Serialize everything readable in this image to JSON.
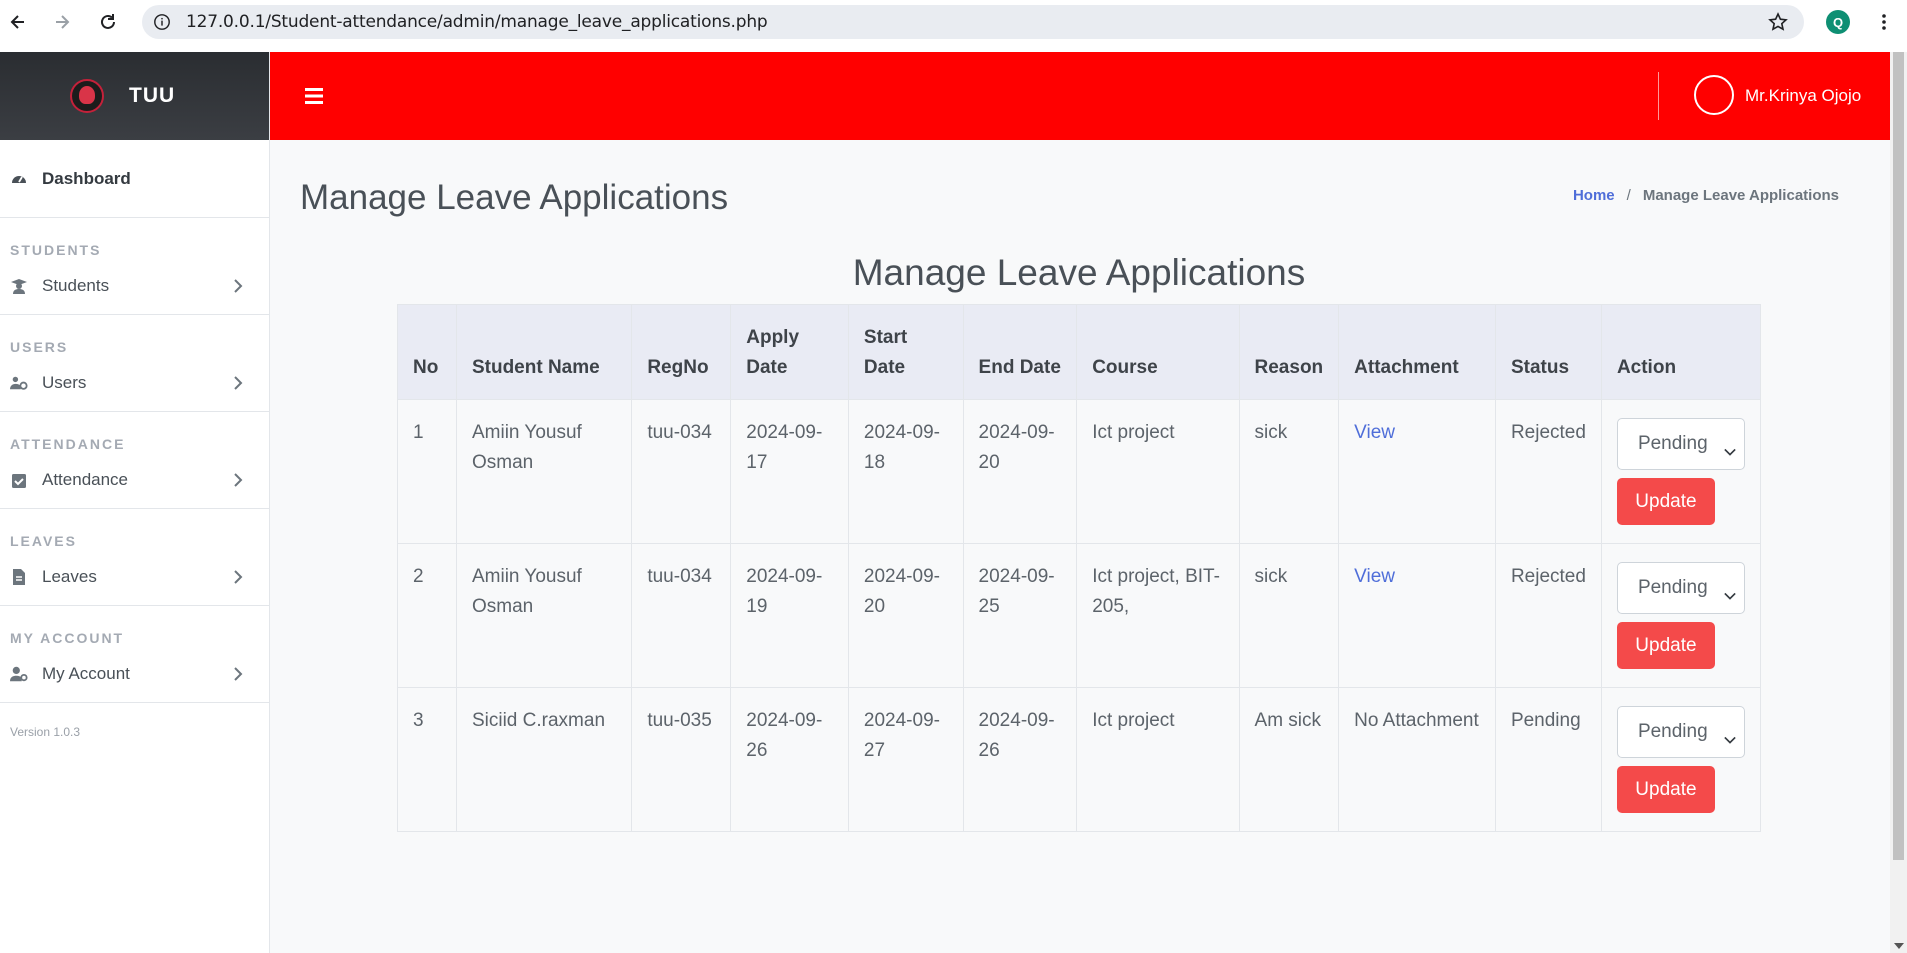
{
  "browser": {
    "url": "127.0.0.1/Student-attendance/admin/manage_leave_applications.php",
    "profile_initial": "Q"
  },
  "brand": {
    "name": "TUU"
  },
  "sidebar": {
    "dashboard": "Dashboard",
    "sections": [
      {
        "label": "STUDENTS",
        "item": "Students"
      },
      {
        "label": "USERS",
        "item": "Users"
      },
      {
        "label": "ATTENDANCE",
        "item": "Attendance"
      },
      {
        "label": "LEAVES",
        "item": "Leaves"
      },
      {
        "label": "MY ACCOUNT",
        "item": "My Account"
      }
    ],
    "version": "Version 1.0.3"
  },
  "header": {
    "user_name": "Mr.Krinya Ojojo",
    "accent_color": "#ff0000"
  },
  "page": {
    "title": "Manage Leave Applications",
    "breadcrumb": {
      "home": "Home",
      "separator": "/",
      "current": "Manage Leave Applications"
    },
    "table_title": "Manage Leave Applications"
  },
  "table": {
    "headers": {
      "no": "No",
      "student_name": "Student Name",
      "regno": "RegNo",
      "apply_date": "Apply Date",
      "start_date": "Start Date",
      "end_date": "End Date",
      "course": "Course",
      "reason": "Reason",
      "attachment": "Attachment",
      "status": "Status",
      "action": "Action"
    },
    "rows": [
      {
        "no": "1",
        "student_name": "Amiin Yousuf Osman",
        "regno": "tuu-034",
        "apply_date": "2024-09-17",
        "start_date": "2024-09-18",
        "end_date": "2024-09-20",
        "course": "Ict project",
        "reason": "sick",
        "attachment": "View",
        "status": "Rejected",
        "select_value": "Pending",
        "button": "Update"
      },
      {
        "no": "2",
        "student_name": "Amiin Yousuf Osman",
        "regno": "tuu-034",
        "apply_date": "2024-09-19",
        "start_date": "2024-09-20",
        "end_date": "2024-09-25",
        "course": "Ict project, BIT-205,",
        "reason": "sick",
        "attachment": "View",
        "status": "Rejected",
        "select_value": "Pending",
        "button": "Update"
      },
      {
        "no": "3",
        "student_name": "Siciid C.raxman",
        "regno": "tuu-035",
        "apply_date": "2024-09-26",
        "start_date": "2024-09-27",
        "end_date": "2024-09-26",
        "course": "Ict project",
        "reason": "Am sick",
        "attachment": "No Attachment",
        "status": "Pending",
        "select_value": "Pending",
        "button": "Update"
      }
    ]
  }
}
